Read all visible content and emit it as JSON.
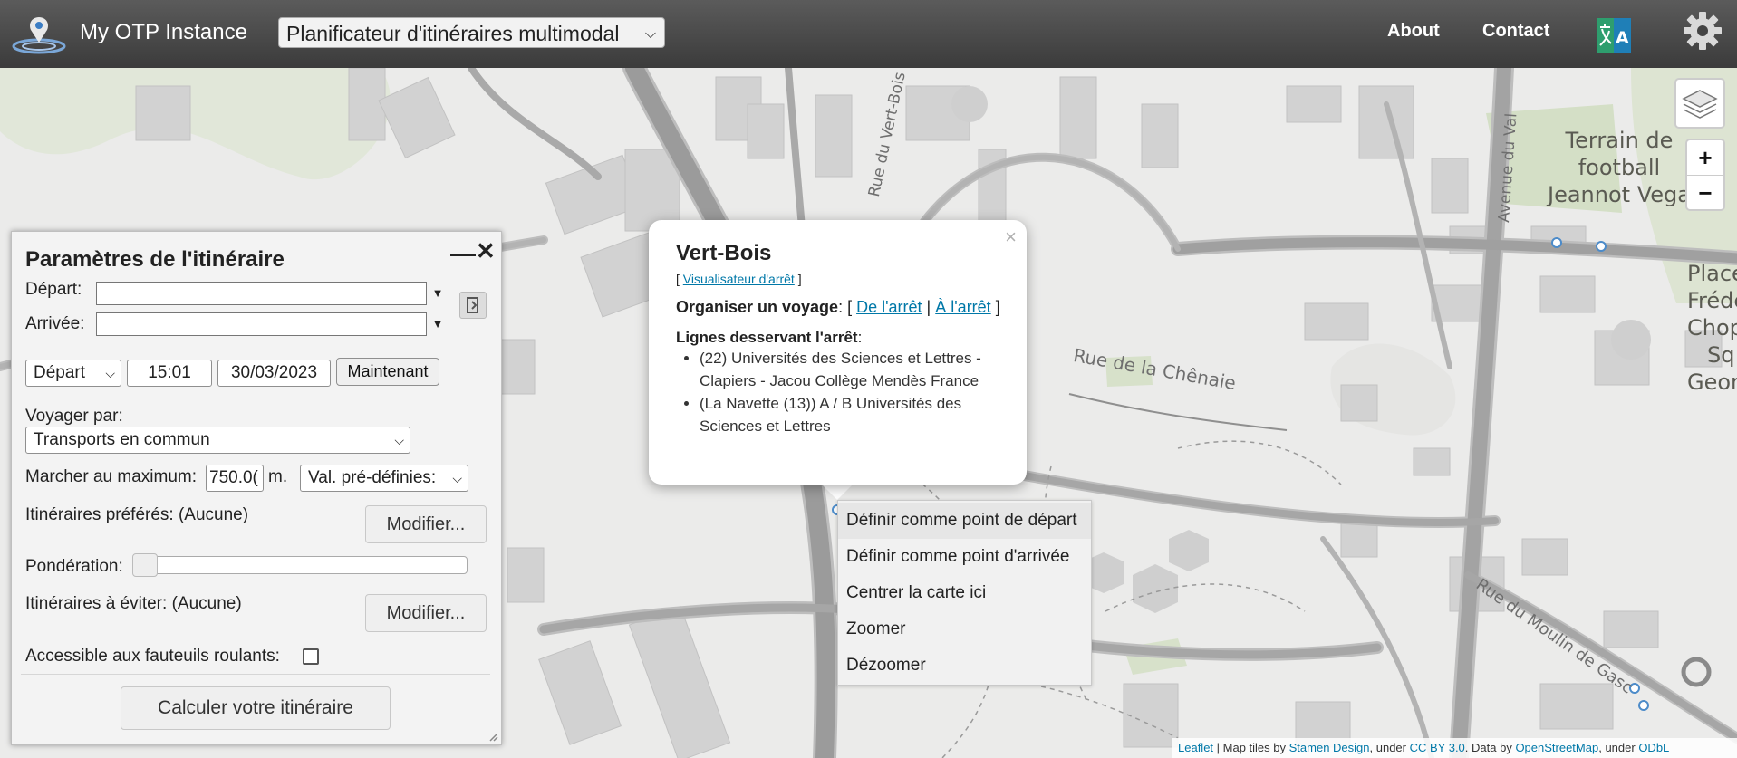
{
  "header": {
    "app_title": "My OTP Instance",
    "mode_select_value": "Planificateur d'itinéraires multimodal",
    "nav": [
      "About",
      "Contact"
    ],
    "icons": [
      "logo-icon",
      "language-icon",
      "gear-icon"
    ]
  },
  "map_labels": {
    "streets": [
      "Rue du Vert-Bois",
      "Rue de la Chênaie",
      "Avenue du Val",
      "Rue du Moulin de Gasc"
    ],
    "football": [
      "Terrain de",
      "football",
      "Jeannot Vega"
    ],
    "place": [
      "Place",
      "Frédé",
      "Chopi",
      "Sq",
      "Georg"
    ]
  },
  "map_controls": {
    "zoom_in": "+",
    "zoom_out": "−"
  },
  "panel": {
    "title": "Paramètres de l'itinéraire",
    "minimize": "—",
    "close": "✕",
    "from_label": "Départ:",
    "to_label": "Arrivée:",
    "from_value": "",
    "to_value": "",
    "depart_arrive_value": "Départ",
    "time_value": "15:01",
    "date_value": "30/03/2023",
    "now_button": "Maintenant",
    "travel_by_label": "Voyager par:",
    "travel_by_value": "Transports en commun",
    "max_walk_label": "Marcher au maximum:",
    "max_walk_value": "750.0(",
    "max_walk_unit": "m.",
    "presets_value": "Val. pré-définies:",
    "preferred_routes": "Itinéraires préférés: (Aucune)",
    "modify_label": "Modifier...",
    "weighting_label": "Pondération:",
    "avoid_routes": "Itinéraires à éviter: (Aucune)",
    "wheelchair_label": "Accessible aux fauteuils roulants:",
    "wheelchair_checked": false,
    "submit": "Calculer votre itinéraire"
  },
  "popup": {
    "close": "×",
    "stop_name": "Vert-Bois",
    "viewer_open": "[ ",
    "viewer_link": "Visualisateur d'arrêt",
    "viewer_close": " ]",
    "trip_label": "Organiser un voyage",
    "trip_colon_open": ": [ ",
    "from_stop": "De l'arrêt",
    "sep": " | ",
    "to_stop": "À l'arrêt",
    "trip_close": " ]",
    "lines_label": "Lignes desservant l'arrêt",
    "lines_colon": ":",
    "lines": [
      "(22) Universités des Sciences et Lettres - Clapiers - Jacou Collège Mendès France",
      "(La Navette (13)) A / B Universités des Sciences et Lettres"
    ]
  },
  "context_menu": [
    "Définir comme point de départ",
    "Définir comme point d'arrivée",
    "Centrer la carte ici",
    "Zoomer",
    "Dézoomer"
  ],
  "attribution": {
    "leaflet": "Leaflet",
    "t1": " | Map tiles by ",
    "stamen": "Stamen Design",
    "t2": ", under ",
    "ccby": "CC BY 3.0",
    "t3": ". Data by ",
    "osm": "OpenStreetMap",
    "t4": ", under ",
    "odbl": "ODbL"
  }
}
